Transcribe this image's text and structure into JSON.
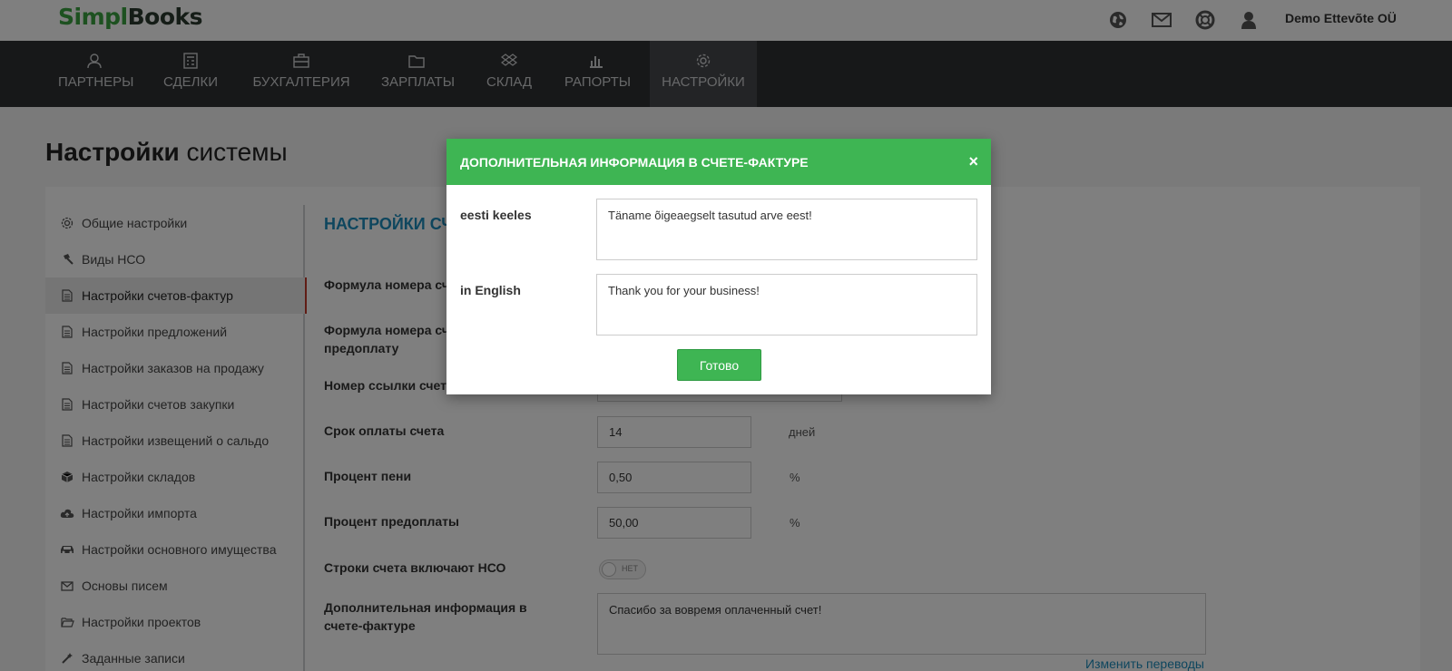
{
  "brand": {
    "simpl": "Simpl",
    "books": "Books"
  },
  "header": {
    "icons": [
      "globe-icon",
      "envelope-icon",
      "lifebuoy-icon",
      "user-icon"
    ],
    "company": "Demo Ettevõte OÜ"
  },
  "nav": {
    "items": [
      {
        "label": "ПАРТНЕРЫ",
        "icon": "user-icon"
      },
      {
        "label": "СДЕЛКИ",
        "icon": "calculator-icon"
      },
      {
        "label": "БУХГАЛТЕРИЯ",
        "icon": "briefcase-icon"
      },
      {
        "label": "ЗАРПЛАТЫ",
        "icon": "folder-icon"
      },
      {
        "label": "СКЛАД",
        "icon": "dropbox-icon"
      },
      {
        "label": "РАПОРТЫ",
        "icon": "bar-chart-icon"
      },
      {
        "label": "НАСТРОЙКИ",
        "icon": "gear-icon",
        "active": true
      }
    ]
  },
  "page": {
    "title_bold": "Настройки",
    "title_rest": "системы"
  },
  "sidebar": {
    "items": [
      {
        "label": "Общие настройки",
        "icon": "gear-icon"
      },
      {
        "label": "Виды НСО",
        "icon": "gavel-icon"
      },
      {
        "label": "Настройки счетов-фактур",
        "icon": "document-icon",
        "active": true
      },
      {
        "label": "Настройки предложений",
        "icon": "document-icon"
      },
      {
        "label": "Настройки заказов на продажу",
        "icon": "document-icon"
      },
      {
        "label": "Настройки счетов закупки",
        "icon": "document-icon"
      },
      {
        "label": "Настройки извещений о сальдо",
        "icon": "document-icon"
      },
      {
        "label": "Настройки складов",
        "icon": "cube-icon"
      },
      {
        "label": "Настройки импорта",
        "icon": "cloud-upload-icon"
      },
      {
        "label": "Настройки основного имущества",
        "icon": "car-icon"
      },
      {
        "label": "Основы писем",
        "icon": "envelope-icon"
      },
      {
        "label": "Настройки проектов",
        "icon": "folder-open-icon"
      },
      {
        "label": "Заданные записи",
        "icon": "magic-wand-icon"
      }
    ]
  },
  "form": {
    "section_title": "НАСТРОЙКИ СЧ",
    "formula_label": "Формула номера сч",
    "formula_prepay_label": "Формула номера сч\nпредоплату",
    "reference_label": "Номер ссылки счет",
    "payment_term_label": "Срок оплаты счета",
    "payment_term_value": "14",
    "payment_term_unit": "дней",
    "penalty_label": "Процент пени",
    "penalty_value": "0,50",
    "penalty_unit": "%",
    "prepay_label": "Процент предоплаты",
    "prepay_value": "50,00",
    "prepay_unit": "%",
    "vat_lines_label": "Строки счета включают НСО",
    "vat_lines_toggle": "НЕТ",
    "extra_info_label": "Дополнительная информация в\nсчете-фактуре",
    "extra_info_value": "Спасибо за вовремя оплаченный счет!",
    "translations_link": "Изменить переводы"
  },
  "modal": {
    "title": "ДОПОЛНИТЕЛЬНАЯ ИНФОРМАЦИЯ В СЧЕТЕ-ФАКТУРЕ",
    "close": "×",
    "fields": [
      {
        "label": "eesti keeles",
        "value": "Täname õigeaegselt tasutud arve eest!"
      },
      {
        "label": "in English",
        "value": "Thank you for your business!"
      }
    ],
    "done": "Готово"
  },
  "colors": {
    "accent_green": "#3eb553",
    "nav_bg": "#2f3033",
    "link_blue": "#1c8dbd",
    "active_marker": "#c0392b"
  }
}
